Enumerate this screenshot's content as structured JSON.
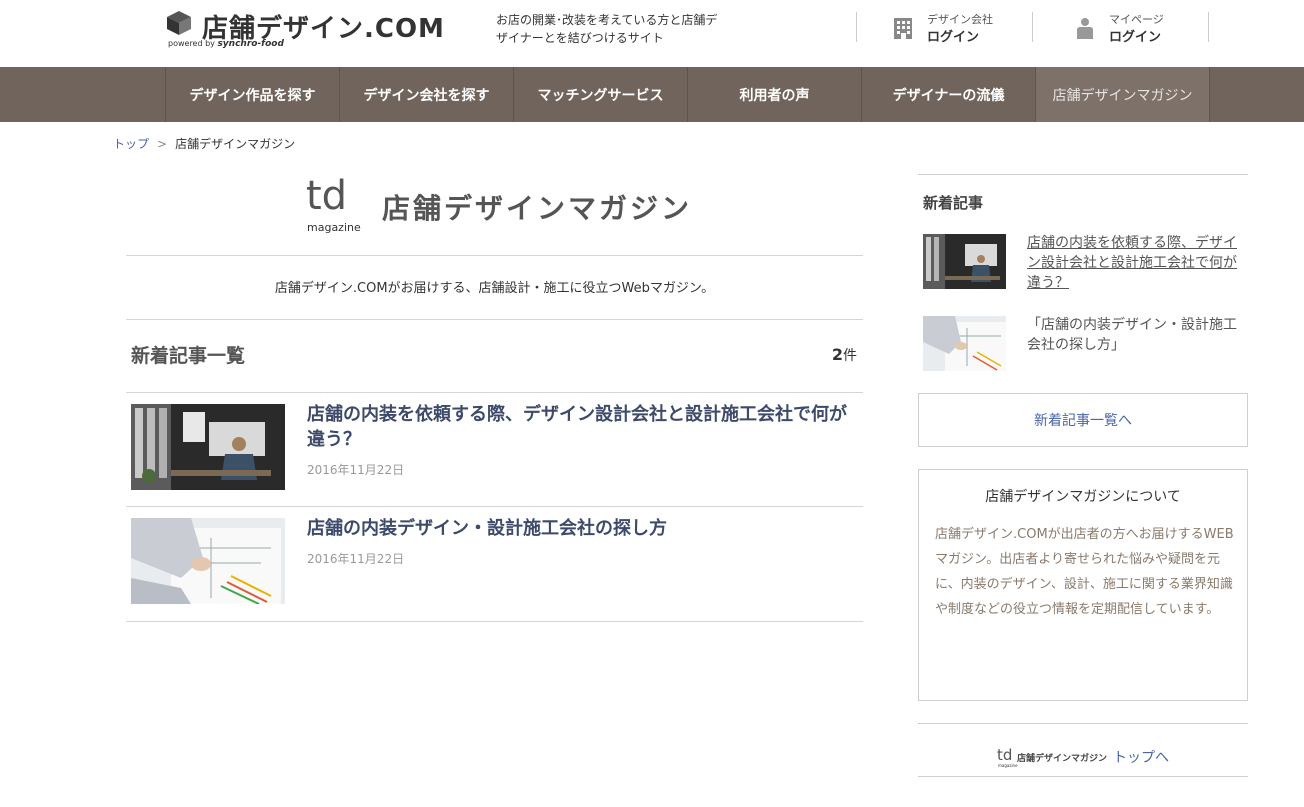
{
  "header": {
    "logo_title": "店舗デザイン.COM",
    "logo_powered": "powered by",
    "logo_brand": "synchro-food",
    "tagline": "お店の開業･改装を考えている方と店舗デザイナーとを結びつけるサイト",
    "company": {
      "small": "デザイン会社",
      "strong": "ログイン",
      "icon": "building-icon"
    },
    "mypage": {
      "small": "マイページ",
      "strong": "ログイン",
      "icon": "person-icon"
    }
  },
  "nav": {
    "items": [
      {
        "label": "デザイン作品を探す"
      },
      {
        "label": "デザイン会社を探す"
      },
      {
        "label": "マッチングサービス"
      },
      {
        "label": "利用者の声"
      },
      {
        "label": "デザイナーの流儀"
      },
      {
        "label": "店舗デザインマガジン",
        "active": true
      }
    ]
  },
  "breadcrumb": {
    "home": "トップ",
    "separator": ">",
    "current": "店舗デザインマガジン"
  },
  "magazine": {
    "logo_mark": "td",
    "logo_small": "magazine",
    "name": "店舗デザインマガジン",
    "description": "店舗デザイン.COMがお届けする、店舗設計・施工に役立つWebマガジン。"
  },
  "list": {
    "title": "新着記事一覧",
    "count": "2",
    "count_unit": "件",
    "articles": [
      {
        "title": "店舗の内装を依頼する際、デザイン設計会社と設計施工会社で何が違う？",
        "date": "2016年11月22日"
      },
      {
        "title": "店舗の内装デザイン・設計施工会社の探し方",
        "date": "2016年11月22日"
      }
    ]
  },
  "sidebar": {
    "heading": "新着記事",
    "items": [
      {
        "text": "店舗の内装を依頼する際、デザイン設計会社と設計施工会社で何が違う？"
      },
      {
        "text": "「店舗の内装デザイン・設計施工会社の探し方」"
      }
    ],
    "all_button": "新着記事一覧へ",
    "about": {
      "title": "店舗デザインマガジンについて",
      "body": "店舗デザイン.COMが出店者の方へお届けするWEBマガジン。出店者より寄せられた悩みや疑問を元に、内装のデザイン、設計、施工に関する業界知識や制度などの役立つ情報を定期配信しています。"
    },
    "footer_link": "トップへ",
    "footer_logo_text": "店舗デザインマガジン"
  },
  "colors": {
    "nav_bg": "#70645d",
    "link": "#4a64a8",
    "article_title": "#3d4a6a",
    "about_text": "#8a7a6c"
  }
}
